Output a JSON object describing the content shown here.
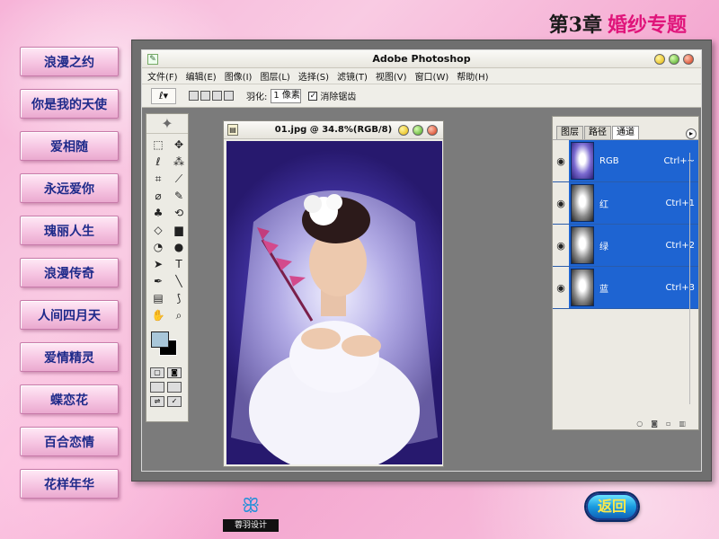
{
  "header": {
    "chapter_number": "第3章",
    "chapter_name": "婚纱专题"
  },
  "side_menu": {
    "items": [
      {
        "label": "浪漫之约"
      },
      {
        "label": "你是我的天使"
      },
      {
        "label": "爱相随"
      },
      {
        "label": "永远爱你"
      },
      {
        "label": "瑰丽人生"
      },
      {
        "label": "浪漫传奇"
      },
      {
        "label": "人间四月天"
      },
      {
        "label": "爱情精灵"
      },
      {
        "label": "蝶恋花"
      },
      {
        "label": "百合恋情"
      },
      {
        "label": "花样年华"
      }
    ]
  },
  "photoshop": {
    "title": "Adobe Photoshop",
    "menus": [
      "文件(F)",
      "编辑(E)",
      "图像(I)",
      "图层(L)",
      "选择(S)",
      "滤镜(T)",
      "视图(V)",
      "窗口(W)",
      "帮助(H)"
    ],
    "options": {
      "feather_label": "羽化:",
      "feather_value": "1 像素",
      "antialias_label": "消除锯齿",
      "antialias_checked": true
    },
    "toolbox": {
      "foreground_color": "#a9c7d9",
      "background_color": "#000000"
    },
    "document": {
      "title": "01.jpg @ 34.8%(RGB/8)"
    },
    "panel": {
      "tabs": [
        "图层",
        "路径",
        "通道"
      ],
      "active_tab": "通道",
      "channels": [
        {
          "name": "RGB",
          "shortcut": "Ctrl+~"
        },
        {
          "name": "红",
          "shortcut": "Ctrl+1"
        },
        {
          "name": "绿",
          "shortcut": "Ctrl+2"
        },
        {
          "name": "蓝",
          "shortcut": "Ctrl+3"
        }
      ]
    }
  },
  "footer": {
    "logo_text": "蓉羽设计",
    "return_label": "返回"
  },
  "colors": {
    "channel_highlight": "#1e64d2",
    "menu_text": "#1e2a8a",
    "chapter_accent": "#e0147a"
  }
}
